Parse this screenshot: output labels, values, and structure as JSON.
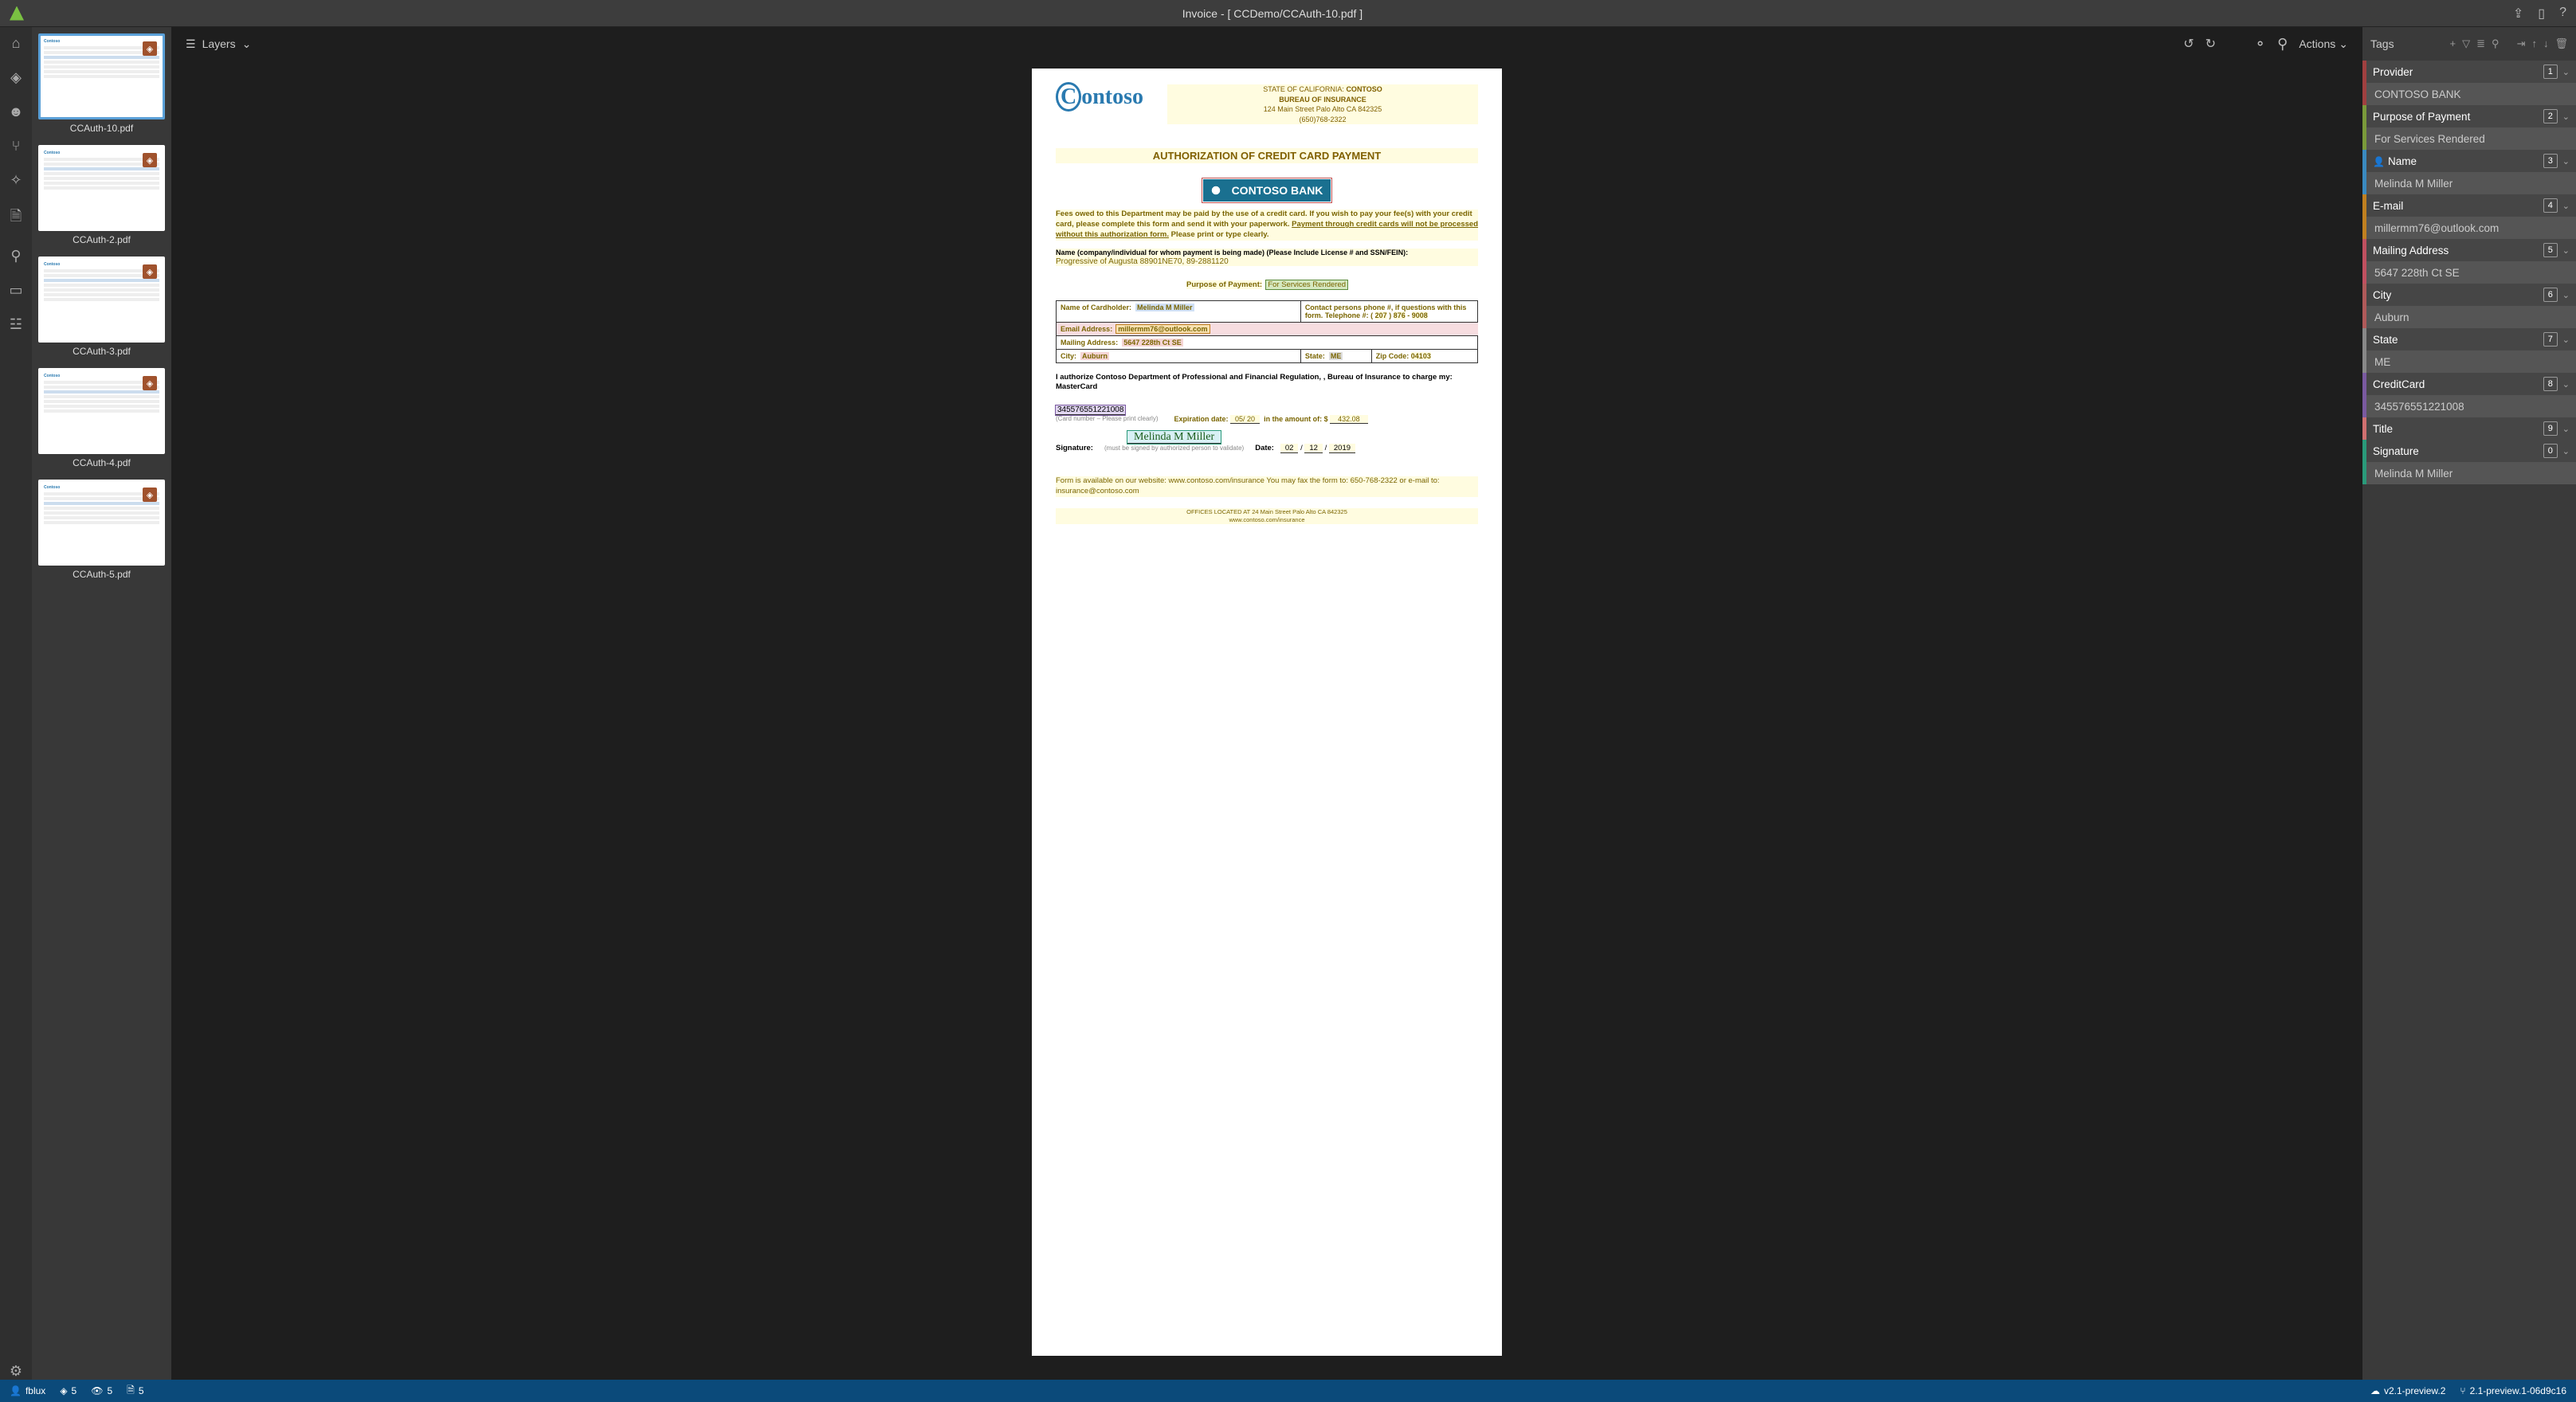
{
  "titlebar": {
    "title": "Invoice - [ CCDemo/CCAuth-10.pdf ]"
  },
  "viewer_toolbar": {
    "layers": "Layers",
    "actions": "Actions"
  },
  "thumbnails": [
    {
      "name": "CCAuth-10.pdf",
      "selected": true
    },
    {
      "name": "CCAuth-2.pdf",
      "selected": false
    },
    {
      "name": "CCAuth-3.pdf",
      "selected": false
    },
    {
      "name": "CCAuth-4.pdf",
      "selected": false
    },
    {
      "name": "CCAuth-5.pdf",
      "selected": false
    }
  ],
  "tags_panel": {
    "title": "Tags",
    "items": [
      {
        "label": "Provider",
        "num": "1",
        "color": "#a04040",
        "value": "CONTOSO BANK"
      },
      {
        "label": "Purpose of Payment",
        "num": "2",
        "color": "#7a9a3a",
        "value": "For Services Rendered",
        "is_person": false
      },
      {
        "label": "Name",
        "num": "3",
        "color": "#3a8ac0",
        "value": "Melinda M Miller",
        "is_person": true
      },
      {
        "label": "E-mail",
        "num": "4",
        "color": "#c08020",
        "value": "millermm76@outlook.com"
      },
      {
        "label": "Mailing Address",
        "num": "5",
        "color": "#c05060",
        "value": "5647 228th Ct SE"
      },
      {
        "label": "City",
        "num": "6",
        "color": "#b05a5a",
        "value": "Auburn"
      },
      {
        "label": "State",
        "num": "7",
        "color": "#888",
        "value": "ME"
      },
      {
        "label": "CreditCard",
        "num": "8",
        "color": "#7a5aa0",
        "value": "345576551221008"
      },
      {
        "label": "Title",
        "num": "9",
        "color": "#d07070",
        "value": null
      },
      {
        "label": "Signature",
        "num": "0",
        "color": "#2a9a7a",
        "value": "Melinda M Miller"
      }
    ]
  },
  "document": {
    "logo": "Contoso",
    "hdr_state": "STATE OF CALIFORNIA:",
    "hdr_co": "CONTOSO",
    "hdr_bureau": "BUREAU OF INSURANCE",
    "hdr_addr": "124 Main Street Palo Alto CA 842325",
    "hdr_phone": "(650)768-2322",
    "auth_title": "AUTHORIZATION OF CREDIT CARD PAYMENT",
    "bank": "CONTOSO BANK",
    "fees_p1": "Fees owed to this Department may be paid by the use of a credit card.  If you wish to pay your fee(s) with your credit card, please complete this form and send it with your paperwork.  ",
    "fees_p2": "Payment through credit cards will not be processed without this authorization form.",
    "fees_p3": "  Please print or type clearly.",
    "name_label": "Name (company/individual for whom payment is being made) (Please Include License # and SSN/FEIN):",
    "name_value": "Progressive of Augusta  88901NE70,  89-2881120",
    "purpose_label": "Purpose of Payment:",
    "purpose_value": "For Services Rendered",
    "cardholder_label": "Name of Cardholder:",
    "cardholder_value": "Melinda M Miller",
    "contact_label": "Contact persons phone #, if questions with this form. Telephone #: (",
    "contact_p1": "207",
    "contact_p2": "876",
    "contact_p3": "9008",
    "email_label": "Email Address:",
    "email_value": "millermm76@outlook.com",
    "mail_label": "Mailing Address:",
    "mail_value": "5647 228th Ct SE",
    "city_label": "City:",
    "city_value": "Auburn",
    "state_label": "State:",
    "state_value": "ME",
    "zip_label": "Zip Code:",
    "zip_value": "04103",
    "auth_text1": "I authorize Contoso Department of Professional and Financial Regulation, , Bureau of Insurance to charge my:   MasterCard",
    "card_number": "345576551221008",
    "card_note": "(Card number – Please print clearly)",
    "exp_label": "Expiration date:",
    "exp_value": "05/ 20",
    "amount_label": "in the amount of: $",
    "amount_value": "432.08",
    "sig_label": "Signature:",
    "sig_value": "Melinda M Miller",
    "sig_note": "(must be signed by authorized person to validate)",
    "date_label": "Date:",
    "date_m": "02",
    "date_d": "12",
    "date_y": "2019",
    "footer1": "Form is available on our website:  www.contoso.com/insurance You may fax the form to: 650-768-2322 or e-mail to:  insurance@contoso.com",
    "footer2": "OFFICES LOCATED AT 24 Main Street Palo Alto CA 842325",
    "footer3": "www.contoso.com/insurance"
  },
  "statusbar": {
    "user": "fblux",
    "c1": "5",
    "c2": "5",
    "c3": "5",
    "ver_left": "v2.1-preview.2",
    "ver_right": "2.1-preview.1-06d9c16"
  }
}
